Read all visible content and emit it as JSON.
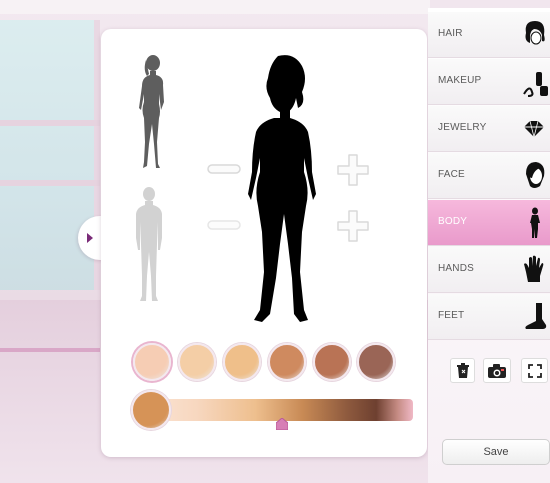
{
  "categories": [
    {
      "label": "HAIR",
      "icon": "hair-icon"
    },
    {
      "label": "MAKEUP",
      "icon": "makeup-icon"
    },
    {
      "label": "JEWELRY",
      "icon": "jewelry-icon"
    },
    {
      "label": "FACE",
      "icon": "face-icon"
    },
    {
      "label": "BODY",
      "icon": "body-icon",
      "active": true
    },
    {
      "label": "HANDS",
      "icon": "hands-icon"
    },
    {
      "label": "FEET",
      "icon": "feet-icon"
    }
  ],
  "toolbar": {
    "tools": [
      "trash-icon",
      "camera-icon",
      "fullscreen-icon"
    ]
  },
  "save_label": "Save",
  "skin_tones": [
    "#f6cdb4",
    "#f4cea6",
    "#efbf8a",
    "#cf8a5f",
    "#b97355",
    "#9a6556"
  ],
  "selected_tone": "#f6cdb4",
  "slider": {
    "preview_color": "#d69357",
    "position_fraction": 0.5
  },
  "colors": {
    "accent_pink": "#e99acb",
    "expand_arrow": "#7a2b78"
  }
}
